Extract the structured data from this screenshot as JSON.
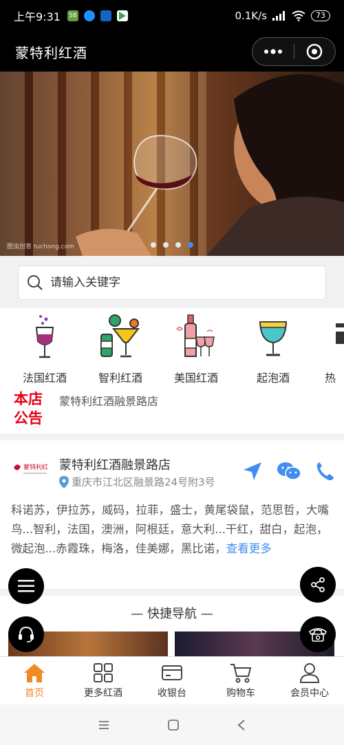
{
  "status_bar": {
    "time": "上午9:31",
    "speed": "0.1K/s",
    "battery": "73"
  },
  "navbar": {
    "title": "蒙特利红酒"
  },
  "banner": {
    "watermark": "图虫创意 tuchong.com",
    "slide_count": 4,
    "active_index": 3
  },
  "search": {
    "placeholder": "请输入关键字"
  },
  "categories": [
    {
      "label": "法国红酒",
      "icon": "wine-glass-icon"
    },
    {
      "label": "智利红酒",
      "icon": "cocktail-icon"
    },
    {
      "label": "美国红酒",
      "icon": "wine-bottle-glasses-icon"
    },
    {
      "label": "起泡酒",
      "icon": "sparkling-glass-icon"
    },
    {
      "label": "热",
      "icon": "hot-drink-icon"
    }
  ],
  "notice": {
    "tag_line1": "本店",
    "tag_line2": "公告",
    "text": "蒙特利红酒融景路店"
  },
  "store": {
    "logo_text": "蒙特利红酒",
    "name": "蒙特利红酒融景路店",
    "address": "重庆市江北区融景路24号附3号",
    "description": "科诺苏，伊拉苏，威码，拉菲，盛士，黄尾袋鼠，范思哲，大嘴鸟...智利，法国，澳洲，阿根廷，意大利...干红，甜白，起泡，微起泡...赤霞珠，梅洛，佳美娜，黑比诺，",
    "more_link": "查看更多"
  },
  "quick_nav": {
    "title": "— 快捷导航 —"
  },
  "tabbar": [
    {
      "label": "首页",
      "active": true
    },
    {
      "label": "更多红酒",
      "active": false
    },
    {
      "label": "收银台",
      "active": false
    },
    {
      "label": "购物车",
      "active": false
    },
    {
      "label": "会员中心",
      "active": false
    }
  ],
  "colors": {
    "accent": "#f08a24",
    "link": "#3f8ef0",
    "notice_red": "#e60012"
  }
}
